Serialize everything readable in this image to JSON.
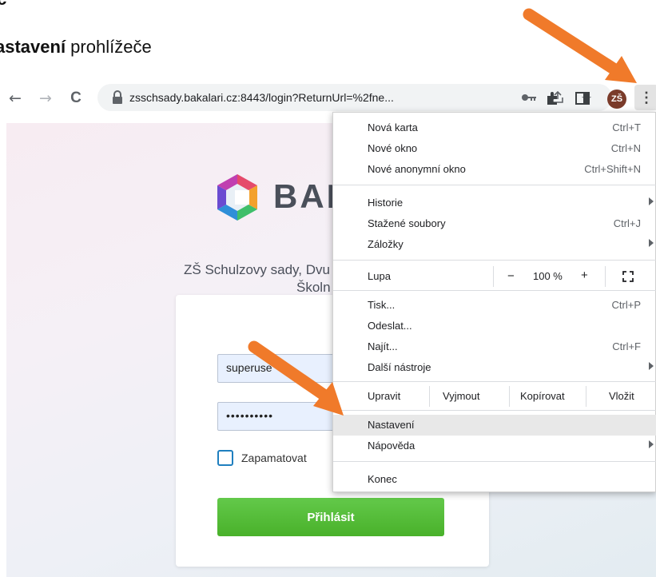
{
  "document": {
    "line1": "ic",
    "line2_bold": "astavení",
    "line2_rest": " prohlížeče"
  },
  "toolbar": {
    "back": "←",
    "forward": "→",
    "reload": "C",
    "url": "zsschsady.bakalari.cz:8443/login?ReturnUrl=%2fne...",
    "avatar_initials": "ZŠ",
    "menu_glyph": "⋮"
  },
  "page": {
    "brand": "BAK",
    "school_line1": "ZŠ Schulzovy sady, Dvu",
    "school_line2": "Školn",
    "login": {
      "username_value": "superuse",
      "password_value": "••••••••••",
      "remember_label": "Zapamatovat",
      "login_button": "Přihlásit"
    }
  },
  "menu": {
    "items_top": [
      {
        "label": "Nová karta",
        "shortcut": "Ctrl+T"
      },
      {
        "label": "Nové okno",
        "shortcut": "Ctrl+N"
      },
      {
        "label": "Nové anonymní okno",
        "shortcut": "Ctrl+Shift+N"
      }
    ],
    "items_history": [
      {
        "label": "Historie",
        "shortcut": ""
      },
      {
        "label": "Stažené soubory",
        "shortcut": "Ctrl+J"
      },
      {
        "label": "Záložky",
        "shortcut": ""
      }
    ],
    "zoom": {
      "label": "Lupa",
      "minus": "−",
      "value": "100 %",
      "plus": "+"
    },
    "items_print": [
      {
        "label": "Tisk...",
        "shortcut": "Ctrl+P"
      },
      {
        "label": "Odeslat...",
        "shortcut": ""
      },
      {
        "label": "Najít...",
        "shortcut": "Ctrl+F"
      },
      {
        "label": "Další nástroje",
        "shortcut": ""
      }
    ],
    "edit": {
      "label": "Upravit",
      "cut": "Vyjmout",
      "copy": "Kopírovat",
      "paste": "Vložit"
    },
    "settings": "Nastavení",
    "help": "Nápověda",
    "exit": "Konec"
  },
  "colors": {
    "arrow": "#f07a2a",
    "login_button": "#52b934",
    "menu_highlight": "#e8e8e8"
  }
}
